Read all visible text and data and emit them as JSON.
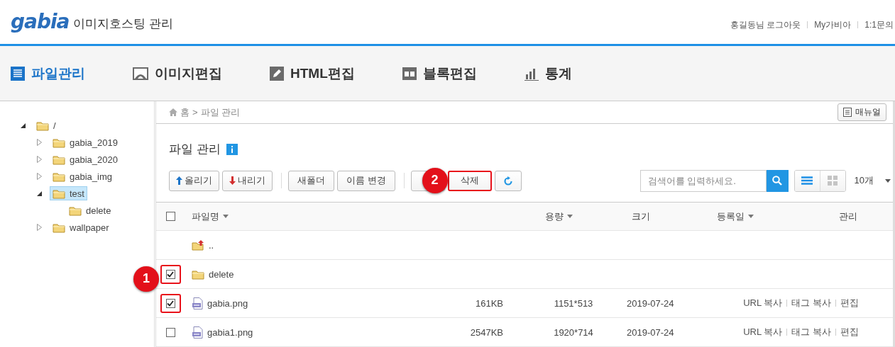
{
  "header": {
    "logo": "gabia",
    "subtitle": "이미지호스팅 관리",
    "links": [
      "홍길동님",
      "로그아웃",
      "My가비아",
      "1:1문의"
    ]
  },
  "nav": [
    {
      "label": "파일관리",
      "kind": "list",
      "selected": true
    },
    {
      "label": "이미지편집",
      "kind": "image",
      "selected": false
    },
    {
      "label": "HTML편집",
      "kind": "pencil",
      "selected": false
    },
    {
      "label": "블록편집",
      "kind": "block",
      "selected": false
    },
    {
      "label": "통계",
      "kind": "chart",
      "selected": false
    }
  ],
  "tree": [
    {
      "label": "/",
      "expanded": true,
      "selected": false,
      "children": [
        {
          "label": "gabia_2019",
          "expanded": false,
          "selected": false
        },
        {
          "label": "gabia_2020",
          "expanded": false,
          "selected": false
        },
        {
          "label": "gabia_img",
          "expanded": false,
          "selected": false
        },
        {
          "label": "test",
          "expanded": true,
          "selected": true,
          "children": [
            {
              "label": "delete",
              "selected": false
            }
          ]
        },
        {
          "label": "wallpaper",
          "expanded": false,
          "selected": false
        }
      ]
    }
  ],
  "breadcrumb": {
    "items": [
      "홈",
      "파일 관리"
    ],
    "separator": ">"
  },
  "manual_button": "매뉴얼",
  "page_title": "파일 관리",
  "toolbar": [
    {
      "kind": "upload",
      "label": "올리기",
      "highlighted": false
    },
    {
      "kind": "download",
      "label": "내리기",
      "highlighted": false
    },
    {
      "kind": "divider"
    },
    {
      "kind": "plain",
      "label": "새폴더",
      "highlighted": false
    },
    {
      "kind": "plain",
      "label": "이름 변경",
      "highlighted": false
    },
    {
      "kind": "divider"
    },
    {
      "kind": "covered",
      "callout": "2"
    },
    {
      "kind": "plain",
      "label": "삭제",
      "highlighted": true
    },
    {
      "kind": "refresh",
      "highlighted": false
    }
  ],
  "search": {
    "placeholder": "검색어를 입력하세요."
  },
  "view_modes": [
    {
      "kind": "list",
      "selected": true
    },
    {
      "kind": "grid",
      "selected": false
    }
  ],
  "page_size": "10개",
  "select_all_checked": false,
  "columns": [
    {
      "label": "파일명",
      "sortable": true
    },
    {
      "label": "용량",
      "sortable": true
    },
    {
      "label": "크기",
      "sortable": false
    },
    {
      "label": "등록일",
      "sortable": true
    },
    {
      "label": "관리",
      "sortable": false
    }
  ],
  "rows": [
    {
      "kind": "parent",
      "name": ".."
    },
    {
      "kind": "folder",
      "name": "delete",
      "checked": true,
      "highlighted": true,
      "callout": "1"
    },
    {
      "kind": "image",
      "name": "gabia.png",
      "checked": true,
      "highlighted": true,
      "size": "161KB",
      "dimensions": "1151*513",
      "date": "2019-07-24",
      "actions": [
        "URL 복사",
        "태그 복사",
        "편집"
      ]
    },
    {
      "kind": "image",
      "name": "gabia1.png",
      "checked": false,
      "highlighted": false,
      "size": "2547KB",
      "dimensions": "1920*714",
      "date": "2019-07-24",
      "actions": [
        "URL 복사",
        "태그 복사",
        "편집"
      ]
    }
  ]
}
